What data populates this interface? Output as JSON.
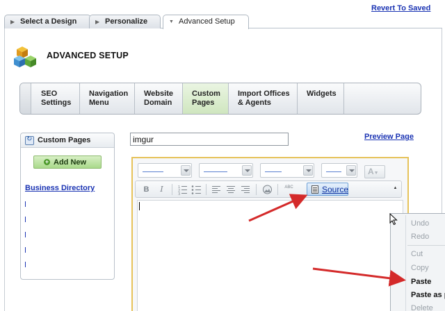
{
  "top_tabs": [
    {
      "label": "Select a Design",
      "active": false
    },
    {
      "label": "Personalize",
      "active": false
    },
    {
      "label": "Advanced Setup",
      "active": true
    }
  ],
  "revert_link": "Revert To Saved",
  "page_title": "ADVANCED SETUP",
  "nav_items": [
    {
      "line1": "SEO",
      "line2": "Settings",
      "active": false
    },
    {
      "line1": "Navigation",
      "line2": "Menu",
      "active": false
    },
    {
      "line1": "Website",
      "line2": "Domain",
      "active": false
    },
    {
      "line1": "Custom",
      "line2": "Pages",
      "active": true
    },
    {
      "line1": "Import Offices",
      "line2": "& Agents",
      "active": false
    },
    {
      "line1": "Widgets",
      "line2": "",
      "active": false
    }
  ],
  "left_panel": {
    "title": "Custom Pages",
    "add_button": "Add New",
    "pages": [
      "Business Directory"
    ]
  },
  "page_name_input": {
    "value": "imgur"
  },
  "preview_link": "Preview Page",
  "editor": {
    "source_label": "Source",
    "bold_label": "B",
    "italic_label": "I",
    "font_color_label": "A",
    "spell_label": "ABC",
    "content": ""
  },
  "context_menu": {
    "items": [
      {
        "label": "Undo",
        "enabled": false
      },
      {
        "label": "Redo",
        "enabled": false
      },
      {
        "label": "Cut",
        "enabled": false
      },
      {
        "label": "Copy",
        "enabled": false
      },
      {
        "label": "Paste",
        "enabled": true
      },
      {
        "label": "Paste as pl",
        "enabled": true
      },
      {
        "label": "Delete",
        "enabled": false
      }
    ]
  },
  "colors": {
    "link": "#1a33b3",
    "active_tab_green": "#cfe6bf",
    "editor_border": "#e6c25a",
    "annotation_arrow": "#d42a2a"
  }
}
